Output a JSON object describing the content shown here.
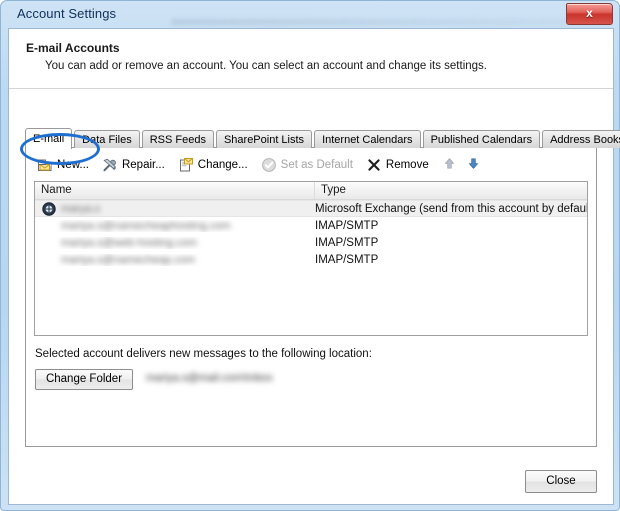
{
  "window": {
    "title": "Account Settings",
    "close_glyph": "x"
  },
  "header": {
    "title": "E-mail Accounts",
    "subtitle": "You can add or remove an account. You can select an account and change its settings."
  },
  "tabs": [
    {
      "label": "E-mail",
      "selected": true
    },
    {
      "label": "Data Files",
      "selected": false
    },
    {
      "label": "RSS Feeds",
      "selected": false
    },
    {
      "label": "SharePoint Lists",
      "selected": false
    },
    {
      "label": "Internet Calendars",
      "selected": false
    },
    {
      "label": "Published Calendars",
      "selected": false
    },
    {
      "label": "Address Books",
      "selected": false
    }
  ],
  "toolbar": {
    "new_label": "New...",
    "repair_label": "Repair...",
    "change_label": "Change...",
    "set_default_label": "Set as Default",
    "remove_label": "Remove",
    "move_up_label": "",
    "move_down_label": ""
  },
  "list": {
    "columns": [
      "Name",
      "Type"
    ],
    "rows": [
      {
        "name": "marya.s",
        "type": "Microsoft Exchange (send from this account by default)",
        "selected": true,
        "has_icon": true
      },
      {
        "name": "mariya.s@namecheaphosting.com",
        "type": "IMAP/SMTP",
        "selected": false,
        "has_icon": false
      },
      {
        "name": "mariya.s@web-hosting.com",
        "type": "IMAP/SMTP",
        "selected": false,
        "has_icon": false
      },
      {
        "name": "mariya.s@namecheap.com",
        "type": "IMAP/SMTP",
        "selected": false,
        "has_icon": false
      }
    ]
  },
  "delivery": {
    "label": "Selected account delivers new messages to the following location:",
    "change_folder_label": "Change Folder",
    "path": "mariya.s@mail.com\\Inbox"
  },
  "footer": {
    "close_label": "Close"
  },
  "annotation": {
    "shape": "ellipse",
    "color": "#1f6fd0",
    "targets": "new-button"
  }
}
